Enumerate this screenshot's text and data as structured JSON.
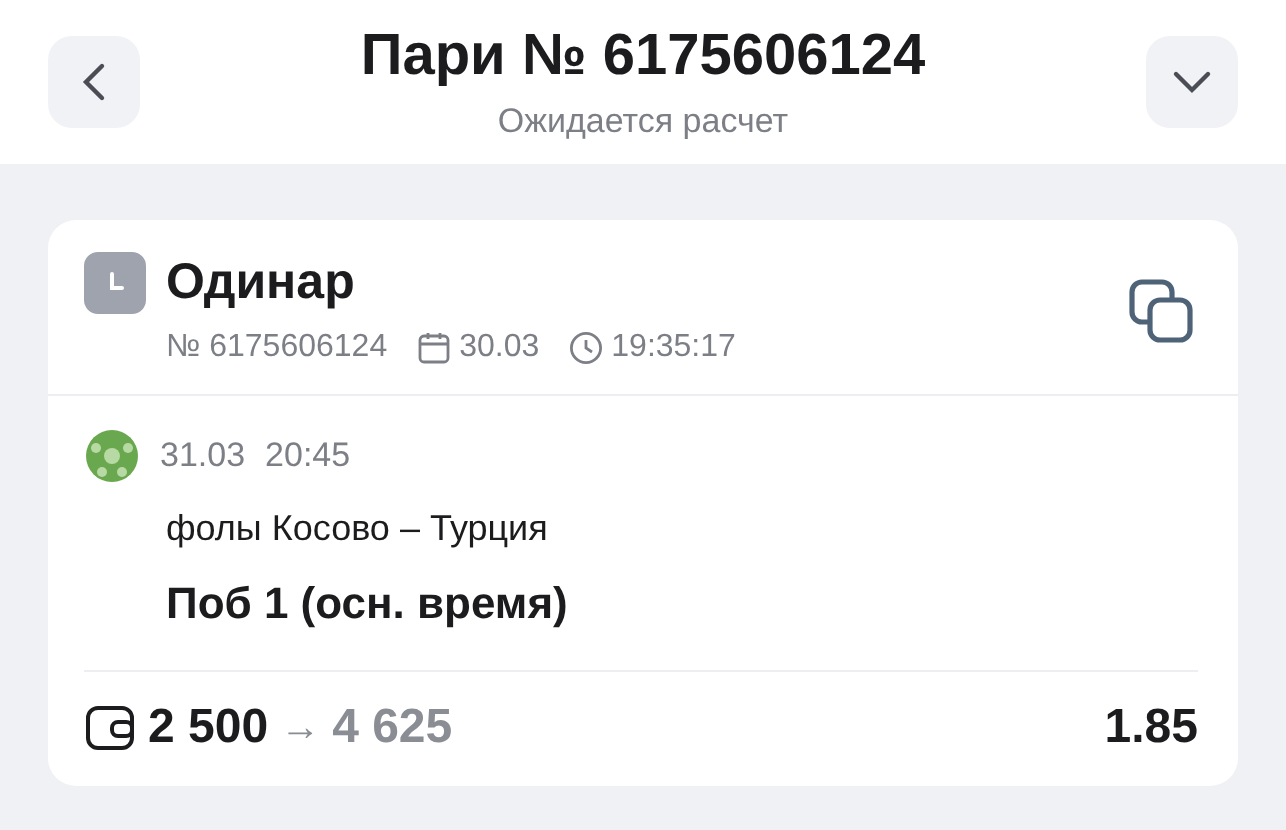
{
  "header": {
    "title": "Пари № 6175606124",
    "subtitle": "Ожидается расчет"
  },
  "bet": {
    "type": "Одинар",
    "number": "№ 6175606124",
    "date": "30.03",
    "time": "19:35:17"
  },
  "event": {
    "date": "31.03",
    "time": "20:45",
    "name": "фолы Косово – Турция",
    "outcome": "Поб 1 (осн. время)"
  },
  "footer": {
    "stake": "2 500",
    "arrow": "→",
    "payout": "4 625",
    "odds": "1.85"
  }
}
